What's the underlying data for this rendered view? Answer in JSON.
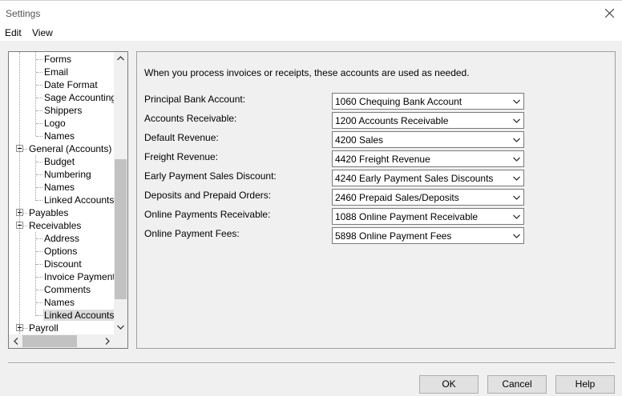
{
  "window": {
    "title": "Settings"
  },
  "menu": {
    "items": [
      "Edit",
      "View"
    ]
  },
  "tree": {
    "items": [
      {
        "label": "Forms",
        "level": 2
      },
      {
        "label": "Email",
        "level": 2
      },
      {
        "label": "Date Format",
        "level": 2
      },
      {
        "label": "Sage Accounting",
        "level": 2
      },
      {
        "label": "Shippers",
        "level": 2
      },
      {
        "label": "Logo",
        "level": 2
      },
      {
        "label": "Names",
        "level": 2
      },
      {
        "label": "General (Accounts)",
        "level": 1,
        "expanded": true
      },
      {
        "label": "Budget",
        "level": 2
      },
      {
        "label": "Numbering",
        "level": 2
      },
      {
        "label": "Names",
        "level": 2
      },
      {
        "label": "Linked Accounts",
        "level": 2
      },
      {
        "label": "Payables",
        "level": 1,
        "expanded": false
      },
      {
        "label": "Receivables",
        "level": 1,
        "expanded": true
      },
      {
        "label": "Address",
        "level": 2
      },
      {
        "label": "Options",
        "level": 2
      },
      {
        "label": "Discount",
        "level": 2
      },
      {
        "label": "Invoice Payments",
        "level": 2
      },
      {
        "label": "Comments",
        "level": 2
      },
      {
        "label": "Names",
        "level": 2
      },
      {
        "label": "Linked Accounts",
        "level": 2,
        "selected": true
      },
      {
        "label": "Payroll",
        "level": 1,
        "expanded": false
      }
    ]
  },
  "panel": {
    "intro": "When you process invoices or receipts, these accounts are used as needed.",
    "fields": [
      {
        "label": "Principal Bank Account:",
        "value": "1060 Chequing Bank Account"
      },
      {
        "label": "Accounts Receivable:",
        "value": "1200 Accounts Receivable"
      },
      {
        "label": "Default Revenue:",
        "value": "4200 Sales"
      },
      {
        "label": "Freight Revenue:",
        "value": "4420 Freight Revenue"
      },
      {
        "label": "Early Payment Sales Discount:",
        "value": "4240 Early Payment Sales Discounts"
      },
      {
        "label": "Deposits and Prepaid Orders:",
        "value": "2460 Prepaid Sales/Deposits"
      },
      {
        "label": "Online Payments Receivable:",
        "value": "1088 Online Payment Receivable"
      },
      {
        "label": "Online Payment Fees:",
        "value": "5898 Online Payment Fees"
      }
    ]
  },
  "buttons": {
    "ok": "OK",
    "cancel": "Cancel",
    "help": "Help"
  }
}
